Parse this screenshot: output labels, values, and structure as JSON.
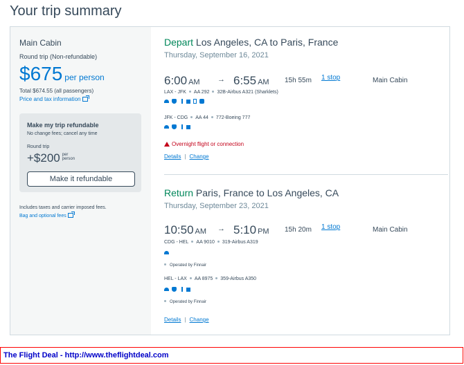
{
  "page": {
    "title": "Your trip summary"
  },
  "sidebar": {
    "cabin": "Main Cabin",
    "trip_type": "Round trip (Non-refundable)",
    "price": "$675",
    "per_person": "per person",
    "total": "Total $674.55 (all passengers)",
    "price_tax_link": "Price and tax information",
    "refund": {
      "title": "Make my trip refundable",
      "no_change_fees": "No change fees; cancel any time",
      "round_trip": "Round trip",
      "price": "+$200",
      "per_person": "per person",
      "button": "Make it refundable"
    },
    "includes": "Includes taxes and carrier imposed fees.",
    "bag_link": "Bag and optional fees"
  },
  "depart": {
    "verb": "Depart",
    "route": "Los Angeles, CA to Paris, France",
    "date": "Thursday, September 16, 2021",
    "dep_time": "6:00",
    "dep_ampm": "AM",
    "arrow": "→",
    "arr_time": "6:55",
    "arr_ampm": "AM",
    "duration": "15h 55m",
    "stops": "1 stop",
    "cabin": "Main Cabin",
    "legs": [
      {
        "route": "LAX - JFK",
        "flight": "AA 292",
        "aircraft": "32B-Airbus A321 (Sharklets)"
      },
      {
        "route": "JFK - CDG",
        "flight": "AA 44",
        "aircraft": "772-Boeing 777"
      }
    ],
    "overnight": "Overnight flight or connection",
    "details_link": "Details",
    "separator": "|",
    "change_link": "Change"
  },
  "return": {
    "verb": "Return",
    "route": "Paris, France to Los Angeles, CA",
    "date": "Thursday, September 23, 2021",
    "dep_time": "10:50",
    "dep_ampm": "AM",
    "arrow": "→",
    "arr_time": "5:10",
    "arr_ampm": "PM",
    "duration": "15h 20m",
    "stops": "1 stop",
    "cabin": "Main Cabin",
    "legs": [
      {
        "route": "CDG - HEL",
        "flight": "AA 9010",
        "aircraft": "319-Airbus A319",
        "operated": "Operated by Finnair"
      },
      {
        "route": "HEL - LAX",
        "flight": "AA 8975",
        "aircraft": "359-Airbus A350",
        "operated": "Operated by Finnair"
      }
    ],
    "details_link": "Details",
    "separator": "|",
    "change_link": "Change"
  },
  "footer": {
    "text": "The Flight Deal - http://www.theflightdeal.com"
  },
  "colors": {
    "accent_blue": "#0078d2",
    "verb_green": "#00875a",
    "warning_red": "#c30019",
    "banner_border": "#ff0000",
    "banner_text": "#0000c8"
  }
}
